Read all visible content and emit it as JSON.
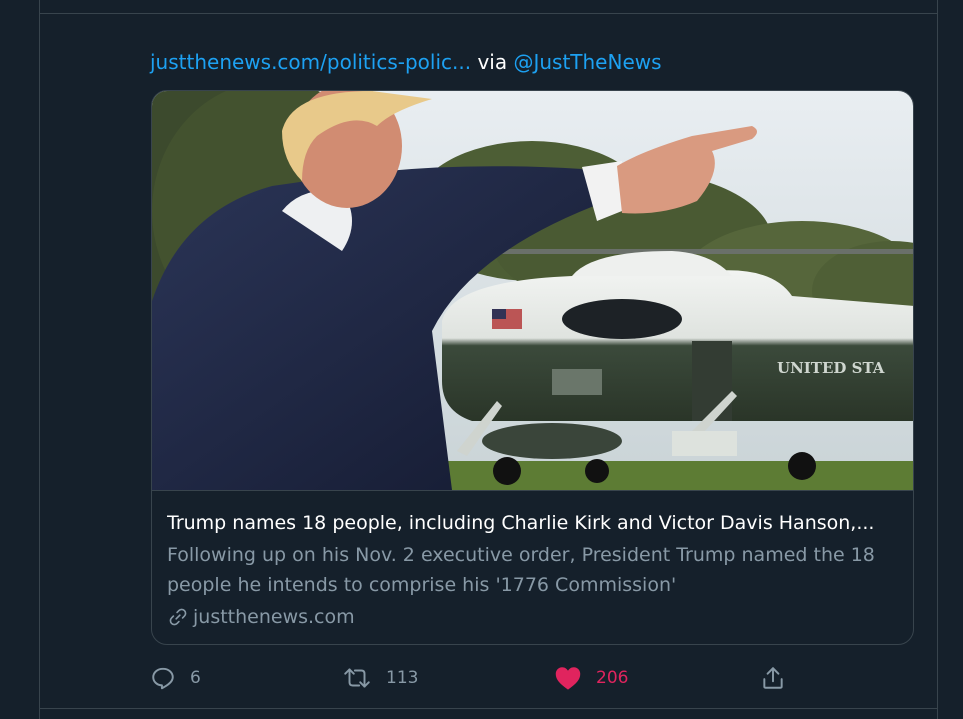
{
  "tweet": {
    "link_text": "justthenews.com/politics-polic...",
    "via_text": "via",
    "via_handle": "@JustTheNews"
  },
  "card": {
    "image_text": "UNITED STA",
    "title": "Trump names 18 people, including Charlie Kirk and Victor Davis Hanson,...",
    "description": "Following up on his Nov. 2 executive order, President Trump named the 18 people he intends to comprise his '1776 Commission'",
    "domain": "justthenews.com"
  },
  "actions": {
    "reply_count": "6",
    "retweet_count": "113",
    "like_count": "206"
  },
  "colors": {
    "background": "#15202b",
    "link": "#1da1f2",
    "muted": "#8899a6",
    "like": "#e0245e",
    "border": "#38444d"
  },
  "icons": {
    "reply": "reply-icon",
    "retweet": "retweet-icon",
    "like": "heart-icon",
    "share": "share-icon",
    "domain": "link-icon"
  }
}
